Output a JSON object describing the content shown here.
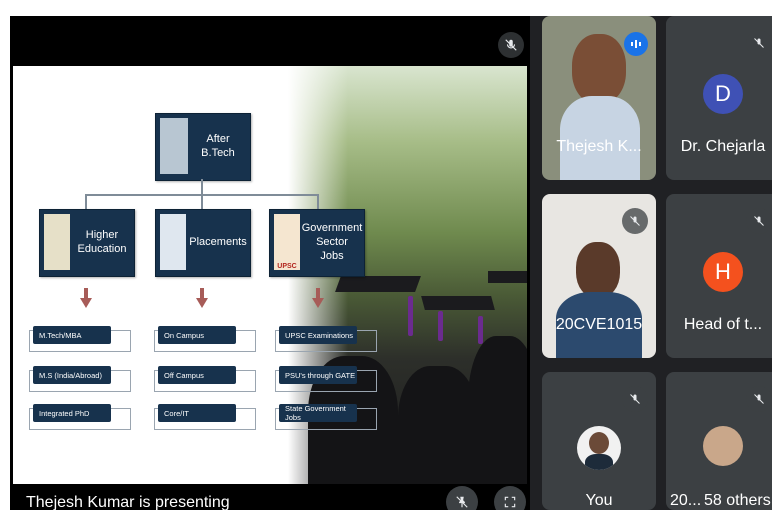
{
  "presenter_caption": "Thejesh Kumar is presenting",
  "slide": {
    "root": "After B.Tech",
    "branches": [
      {
        "label_l1": "Higher",
        "label_l2": "Education",
        "items": [
          "M.Tech/MBA",
          "M.S (India/Abroad)",
          "Integrated PhD"
        ]
      },
      {
        "label_l1": "Placements",
        "label_l2": "",
        "items": [
          "On Campus",
          "Off Campus",
          "Core/IT"
        ]
      },
      {
        "label_l1": "Government",
        "label_l2": "Sector Jobs",
        "items": [
          "UPSC Examinations",
          "PSU's through GATE",
          "State Government Jobs"
        ]
      }
    ],
    "upsc_logo_text": "UPSC"
  },
  "participants": [
    {
      "name": "Thejesh K...",
      "status": "speaking"
    },
    {
      "name": "Dr. Chejarla",
      "initial": "D",
      "avatar_color": "#3f51b5",
      "status": "muted"
    },
    {
      "name": "20CVE1015",
      "status": "muted"
    },
    {
      "name": "Head of t...",
      "initial": "H",
      "avatar_color": "#f4511e",
      "status": "muted"
    },
    {
      "name": "You",
      "status": "muted"
    },
    {
      "name": "20...",
      "others": "58 others",
      "status": "muted"
    }
  ],
  "icons": {
    "mic_off": "mic-off-icon",
    "speaking": "audio-level-icon",
    "pin": "pin-off-icon",
    "fullscreen": "fullscreen-icon"
  }
}
